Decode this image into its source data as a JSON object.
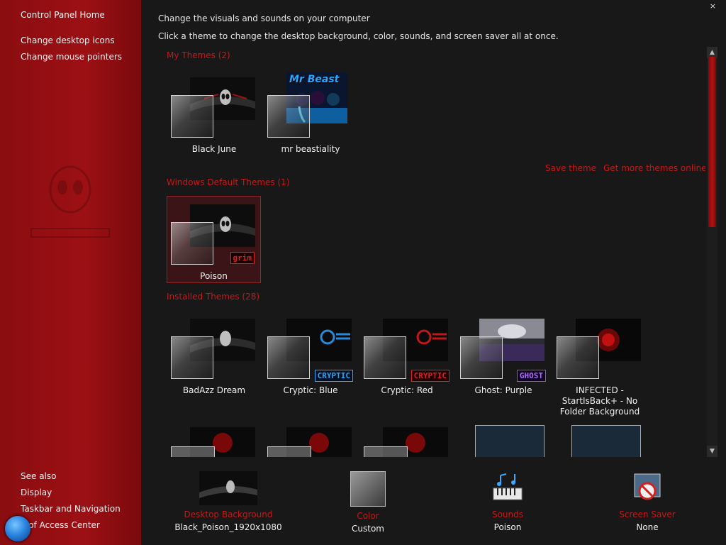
{
  "sidebar": {
    "home": "Control Panel Home",
    "links": [
      "Change desktop icons",
      "Change mouse pointers"
    ],
    "see_also_title": "See also",
    "see_also": [
      "Display",
      "Taskbar and Navigation",
      "e of Access Center"
    ]
  },
  "header": {
    "line1": "Change the visuals and sounds on your computer",
    "line2": "Click a theme to change the desktop background, color, sounds, and screen saver all at once."
  },
  "groups": {
    "my_themes": "My Themes (2)",
    "windows_default": "Windows Default Themes (1)",
    "installed": "Installed Themes (28)"
  },
  "links": {
    "save_theme": "Save theme",
    "get_more": "Get more themes online"
  },
  "themes": {
    "my": [
      {
        "name": "Black June"
      },
      {
        "name": "mr beastiality",
        "art_text": "Mr Beast"
      }
    ],
    "default": [
      {
        "name": "Poison",
        "badge": "grim"
      }
    ],
    "installed": [
      {
        "name": "BadAzz Dream"
      },
      {
        "name": "Cryptic: Blue",
        "badge": "CRYPTIC"
      },
      {
        "name": "Cryptic: Red",
        "badge": "CRYPTIC"
      },
      {
        "name": "Ghost: Purple",
        "badge": "GHOST"
      },
      {
        "name": "INFECTED - StartIsBack+ - No Folder Background"
      }
    ]
  },
  "bottom": {
    "background": {
      "label": "Desktop Background",
      "value": "Black_Poison_1920x1080"
    },
    "color": {
      "label": "Color",
      "value": "Custom"
    },
    "sounds": {
      "label": "Sounds",
      "value": "Poison"
    },
    "screensaver": {
      "label": "Screen Saver",
      "value": "None"
    }
  },
  "colors": {
    "accent_red": "#c41a1a",
    "sidebar_red": "#9c1014",
    "background": "#181818"
  },
  "icons": {
    "close": "close-icon",
    "start": "start-orb-icon"
  }
}
